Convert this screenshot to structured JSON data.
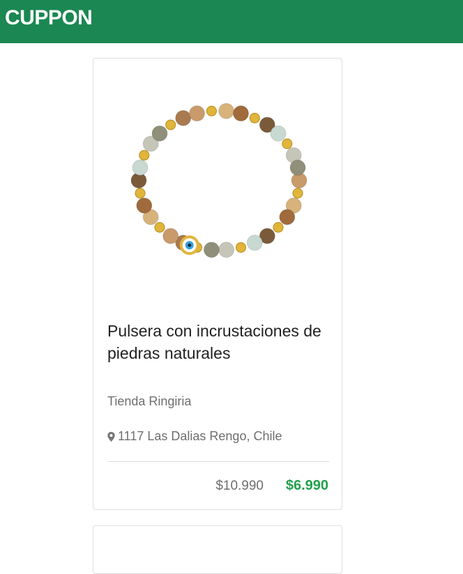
{
  "header": {
    "brand": "CUPPON",
    "brand_color": "#1b8752"
  },
  "product": {
    "image_alt": "bracelet",
    "title": "Pulsera con incrustaciones de piedras naturales",
    "store": "Tienda Ringiria",
    "location_icon": "map-pin-icon",
    "location": "1117 Las Dalias Rengo, Chile",
    "price_original": "$10.990",
    "price_sale": "$6.990",
    "price_sale_color": "#22a04b"
  }
}
